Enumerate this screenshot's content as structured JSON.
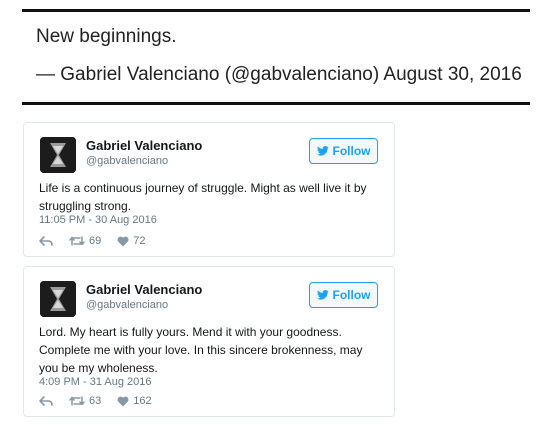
{
  "quote": {
    "text": "New beginnings.",
    "attribution": "— Gabriel Valenciano (@gabvalenciano) August 30, 2016"
  },
  "tweets": [
    {
      "name": "Gabriel Valenciano",
      "handle": "@gabvalenciano",
      "follow_label": "Follow",
      "text": "Life is a continuous journey of struggle. Might as well live it by struggling strong.",
      "timestamp": "11:05 PM - 30 Aug 2016",
      "retweets": "69",
      "likes": "72"
    },
    {
      "name": "Gabriel Valenciano",
      "handle": "@gabvalenciano",
      "follow_label": "Follow",
      "text": "Lord. My heart is fully yours. Mend it with your goodness. Complete me with your love. In this sincere brokenness, may you be my wholeness.",
      "timestamp": "4:09 PM - 31 Aug 2016",
      "retweets": "63",
      "likes": "162"
    }
  ],
  "colors": {
    "accent": "#1da1f2",
    "muted": "#657786",
    "border": "#e1e8ed"
  },
  "icons": [
    "twitter-bird-icon",
    "reply-icon",
    "retweet-icon",
    "heart-icon"
  ]
}
